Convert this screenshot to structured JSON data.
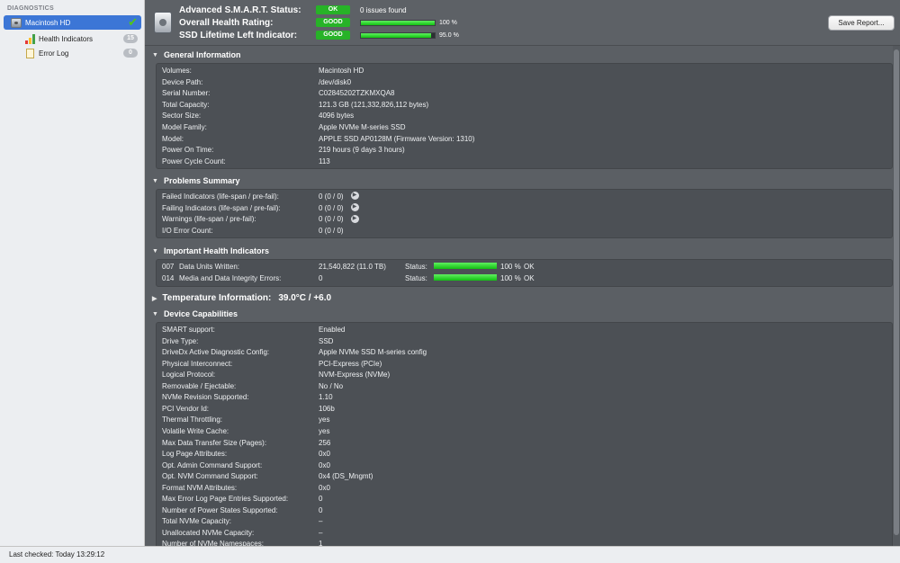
{
  "sidebar": {
    "header": "DIAGNOSTICS",
    "items": [
      {
        "label": "Macintosh HD"
      },
      {
        "label": "Health Indicators",
        "count": "15"
      },
      {
        "label": "Error Log",
        "count": "0"
      }
    ]
  },
  "header": {
    "rows": [
      {
        "label": "Advanced S.M.A.R.T. Status:",
        "badge": "OK",
        "text": "0 issues found"
      },
      {
        "label": "Overall Health Rating:",
        "badge": "GOOD",
        "percent": "100 %",
        "fill": 1.0
      },
      {
        "label": "SSD Lifetime Left Indicator:",
        "badge": "GOOD",
        "percent": "95.0 %",
        "fill": 0.95
      }
    ],
    "save_button": "Save Report..."
  },
  "general": {
    "title": "General Information",
    "rows": [
      {
        "k": "Volumes:",
        "v": "Macintosh HD"
      },
      {
        "k": "Device Path:",
        "v": "/dev/disk0"
      },
      {
        "k": "Serial Number:",
        "v": "C02845202TZKMXQA8"
      },
      {
        "k": "Total Capacity:",
        "v": "121.3 GB (121,332,826,112 bytes)"
      },
      {
        "k": "Sector Size:",
        "v": "4096 bytes"
      },
      {
        "k": "Model Family:",
        "v": "Apple NVMe M-series SSD"
      },
      {
        "k": "Model:",
        "v": "APPLE SSD AP0128M  (Firmware Version: 1310)"
      },
      {
        "k": "Power On Time:",
        "v": "219 hours (9 days 3 hours)"
      },
      {
        "k": "Power Cycle Count:",
        "v": "113"
      }
    ]
  },
  "problems": {
    "title": "Problems Summary",
    "rows": [
      {
        "k": "Failed Indicators (life-span / pre-fail):",
        "v": "0 (0 / 0)",
        "arrow": true
      },
      {
        "k": "Failing Indicators (life-span / pre-fail):",
        "v": "0 (0 / 0)",
        "arrow": true
      },
      {
        "k": "Warnings (life-span / pre-fail):",
        "v": "0 (0 / 0)",
        "arrow": true
      },
      {
        "k": "I/O Error Count:",
        "v": "0 (0 / 0)",
        "arrow": false
      }
    ]
  },
  "health": {
    "title": "Important Health Indicators",
    "status_label": "Status:",
    "rows": [
      {
        "num": "007",
        "name": "Data Units Written:",
        "value": "21,540,822 (11.0 TB)",
        "percent": "100 %",
        "fill": 1.0,
        "state": "OK"
      },
      {
        "num": "014",
        "name": "Media and Data Integrity Errors:",
        "value": "0",
        "percent": "100 %",
        "fill": 1.0,
        "state": "OK"
      }
    ]
  },
  "temperature": {
    "title": "Temperature Information:",
    "value": "39.0°C / +6.0"
  },
  "capabilities": {
    "title": "Device Capabilities",
    "rows": [
      {
        "k": "SMART support:",
        "v": "Enabled"
      },
      {
        "k": "Drive Type:",
        "v": "SSD"
      },
      {
        "k": "DriveDx Active Diagnostic Config:",
        "v": "Apple NVMe SSD M-series config"
      },
      {
        "k": "Physical Interconnect:",
        "v": "PCI-Express (PCIe)"
      },
      {
        "k": "Logical Protocol:",
        "v": "NVM-Express (NVMe)"
      },
      {
        "k": "Removable / Ejectable:",
        "v": "No / No"
      },
      {
        "k": "NVMe Revision Supported:",
        "v": "1.10"
      },
      {
        "k": "PCI Vendor Id:",
        "v": "106b"
      },
      {
        "k": "Thermal Throttling:",
        "v": "yes"
      },
      {
        "k": "Volatile Write Cache:",
        "v": "yes"
      },
      {
        "k": "Max Data Transfer Size (Pages):",
        "v": "256"
      },
      {
        "k": "Log Page Attributes:",
        "v": "0x0"
      },
      {
        "k": "Opt. Admin Command Support:",
        "v": "0x0"
      },
      {
        "k": "Opt. NVM Command Support:",
        "v": "0x4 (DS_Mngmt)"
      },
      {
        "k": "Format NVM Attributes:",
        "v": "0x0"
      },
      {
        "k": "Max Error Log Page Entries Supported:",
        "v": "0"
      },
      {
        "k": "Number of Power States Supported:",
        "v": "0"
      },
      {
        "k": "Total NVMe Capacity:",
        "v": "–"
      },
      {
        "k": "Unallocated NVMe Capacity:",
        "v": "–"
      },
      {
        "k": "Number of NVMe Namespaces:",
        "v": "1"
      }
    ]
  },
  "footer": {
    "status": "Last checked: Today 13:29:12"
  },
  "colors": {
    "accent": "#3c76d6",
    "good": "#27b327",
    "panel": "#4c5055"
  }
}
